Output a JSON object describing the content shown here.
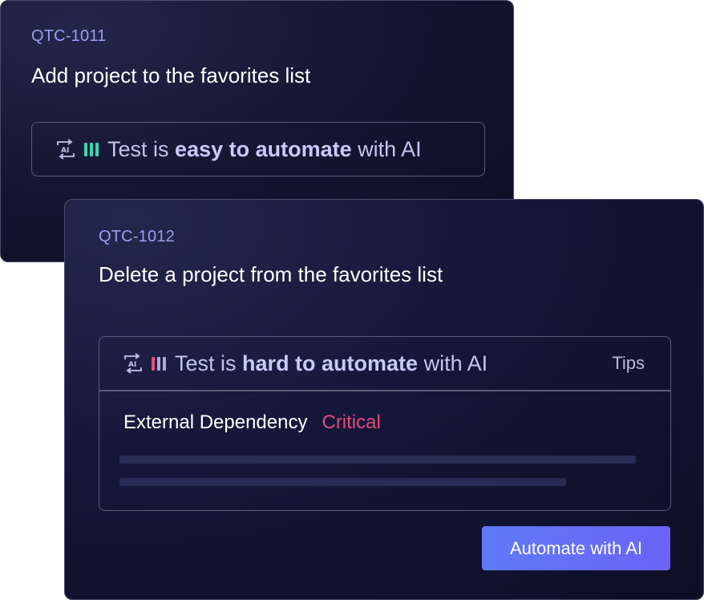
{
  "cards": [
    {
      "id": "QTC-1011",
      "title": "Add project to the favorites list",
      "assessment": {
        "prefix": "Test is",
        "level": "easy to automate",
        "suffix": "with AI",
        "indicator_color": "#3dd6b0",
        "bars_active": 3
      }
    },
    {
      "id": "QTC-1012",
      "title": "Delete a project from the favorites list",
      "assessment": {
        "prefix": "Test is",
        "level": "hard to automate",
        "suffix": "with AI",
        "indicator_color": "#e64b7a",
        "bars_active": 1,
        "tips_label": "Tips",
        "dependency_label": "External Dependency",
        "dependency_severity": "Critical",
        "severity_color": "#e64b7a"
      },
      "action_button_label": "Automate with AI"
    }
  ],
  "icons": {
    "ai_icon": "ai-sync-icon"
  },
  "colors": {
    "accent": "#6b63f5",
    "id_text": "#9a9ef0",
    "easy": "#3dd6b0",
    "hard": "#e64b7a",
    "bar_inactive": "#a9acd6"
  }
}
